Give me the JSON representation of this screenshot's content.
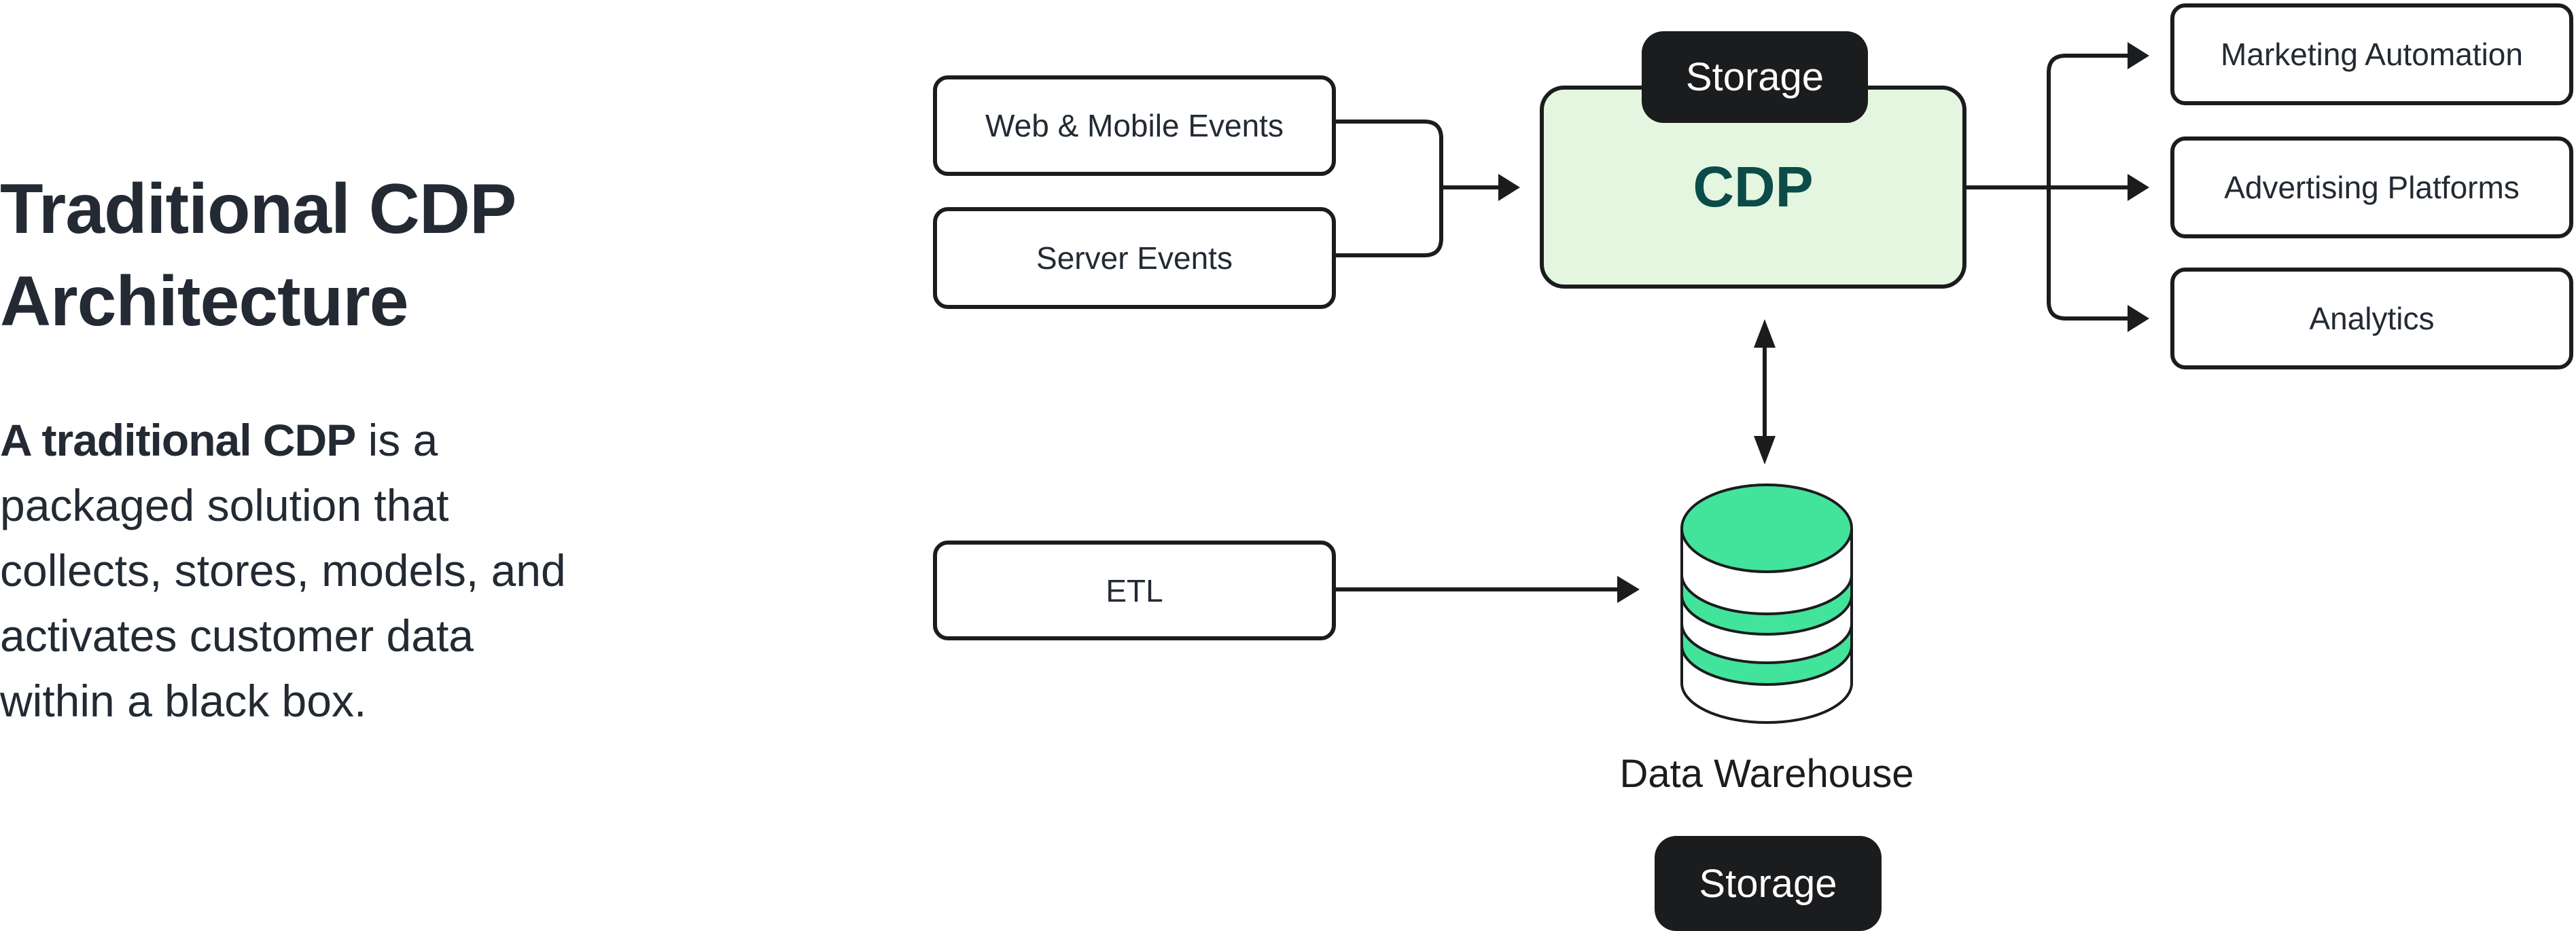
{
  "heading": {
    "title_line1": "Traditional CDP",
    "title_line2": "Architecture",
    "description_bold": "A traditional CDP",
    "description_rest": " is a packaged solution that collects, stores, models, and activates customer data within a black box."
  },
  "diagram": {
    "sources": [
      {
        "label": "Web & Mobile Events"
      },
      {
        "label": "Server Events"
      },
      {
        "label": "ETL"
      }
    ],
    "cdp": {
      "label": "CDP",
      "badge": "Storage"
    },
    "destinations": [
      {
        "label": "Marketing Automation"
      },
      {
        "label": "Advertising Platforms"
      },
      {
        "label": "Analytics"
      }
    ],
    "warehouse": {
      "label": "Data Warehouse",
      "badge": "Storage"
    },
    "colors": {
      "cdp_fill": "#e4f6e0",
      "cdp_text": "#0b4b48",
      "warehouse_green": "#42e39a",
      "stroke": "#1b1c1e"
    }
  }
}
